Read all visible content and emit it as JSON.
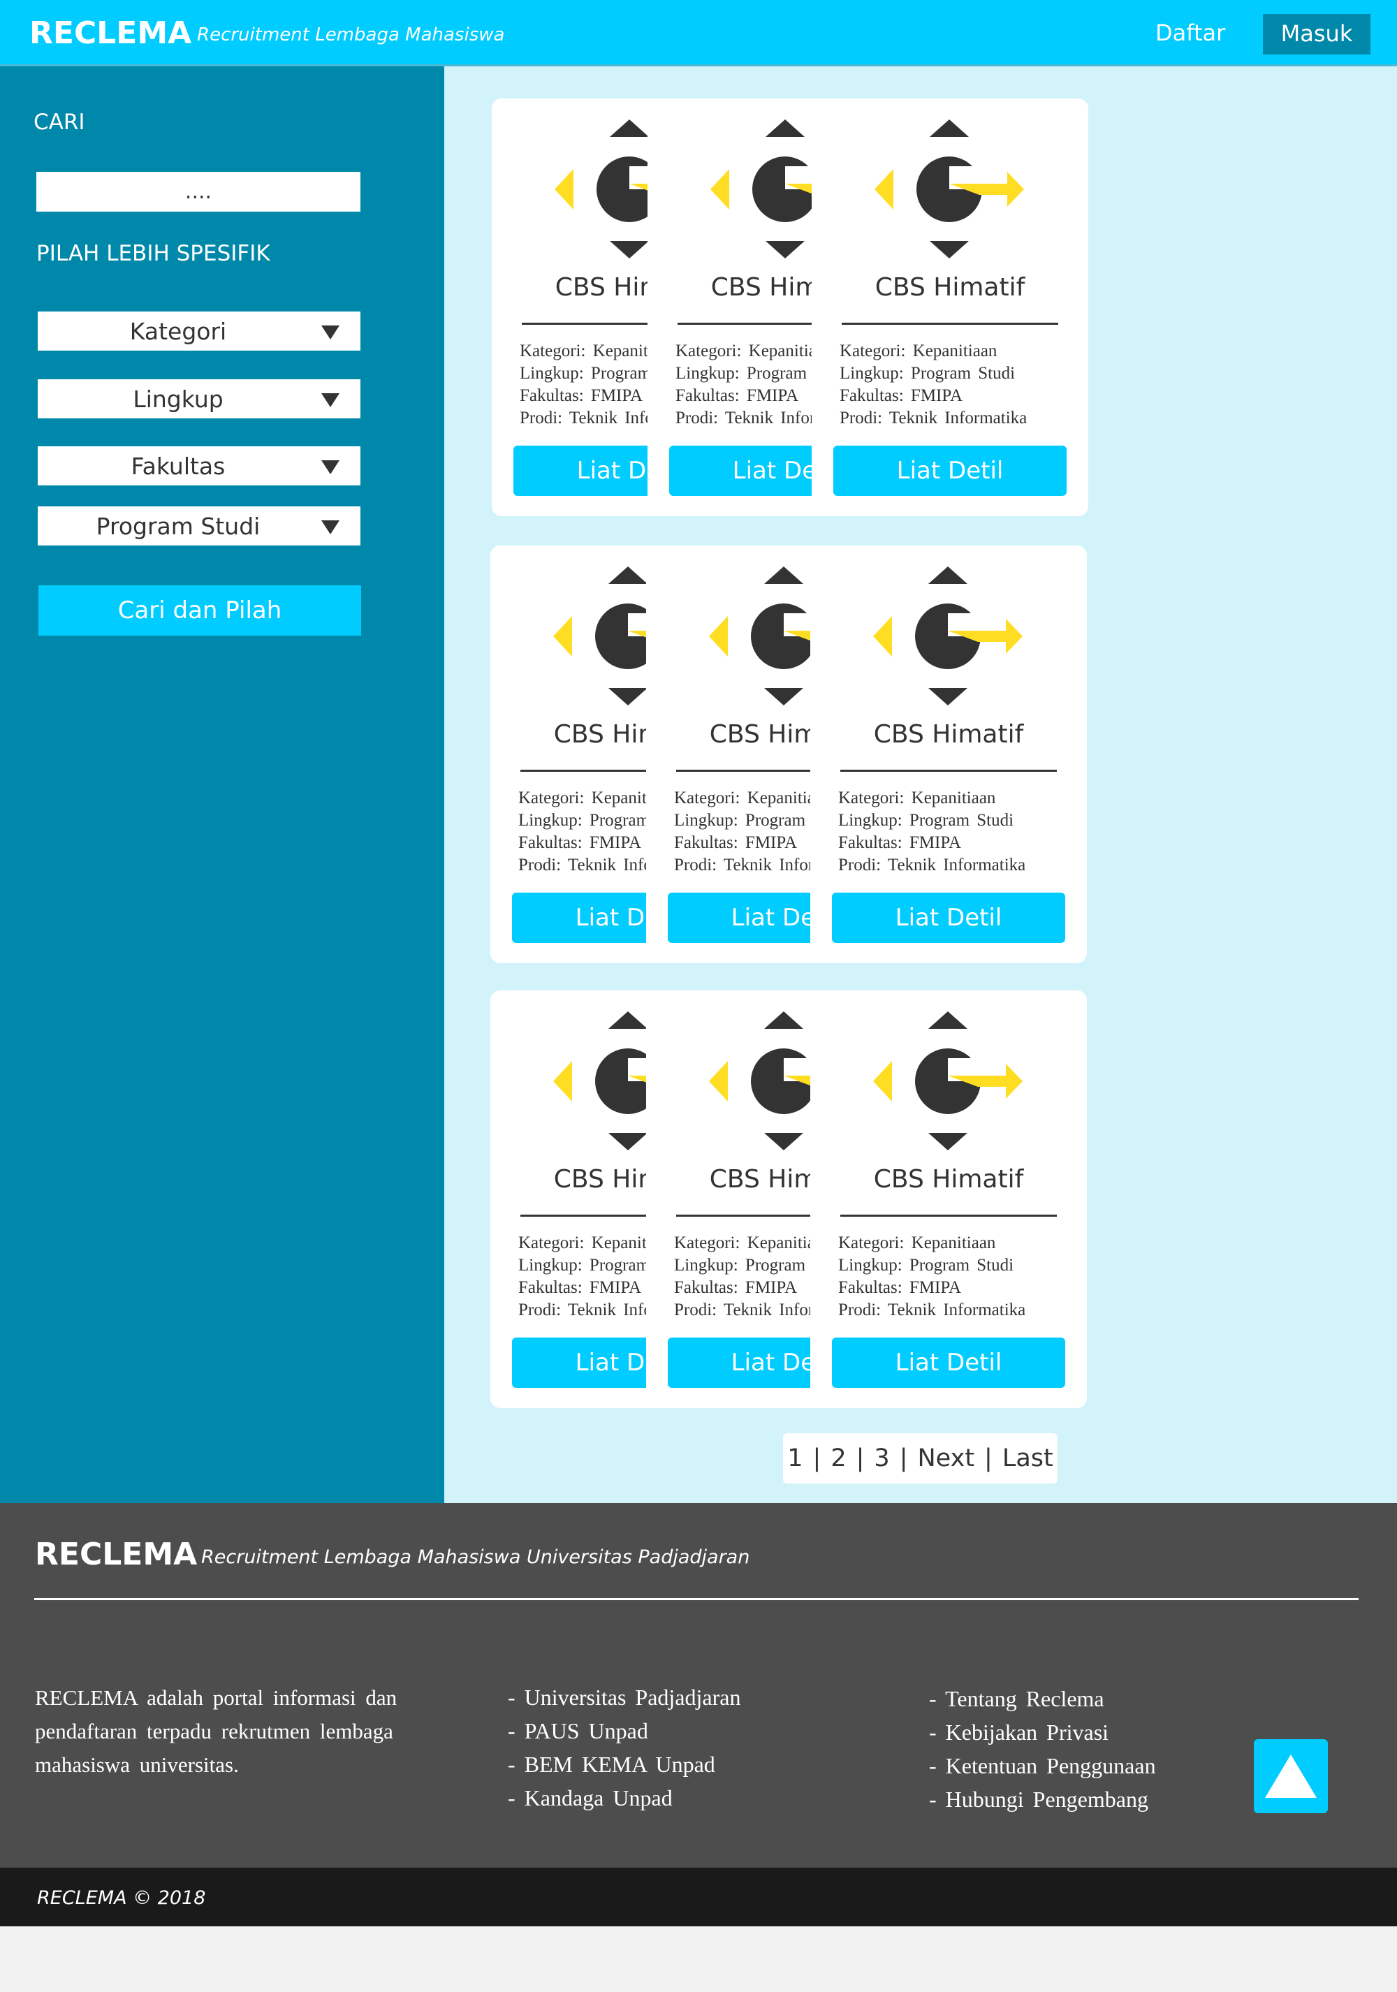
{
  "header": {
    "brand": "RECLEMA",
    "subtitle": "Recruitment Lembaga Mahasiswa",
    "nav_daftar": "Daftar",
    "nav_masuk": "Masuk"
  },
  "sidebar": {
    "search_label": "CARI",
    "search_placeholder": "....",
    "filter_label": "PILAH LEBIH SPESIFIK",
    "filters": [
      {
        "label": "Kategori"
      },
      {
        "label": "Lingkup"
      },
      {
        "label": "Fakultas"
      },
      {
        "label": "Program Studi"
      }
    ],
    "submit_label": "Cari dan Pilah"
  },
  "cards": [
    {
      "title": "CBS Himatif",
      "kategori": "Kategori:  Kepanitiaan",
      "lingkup": "Lingkup:  Program  Studi",
      "fakultas": "Fakultas:  FMIPA",
      "prodi": "Prodi:  Teknik  Informatika",
      "button": "Liat Detil"
    },
    {
      "title": "CBS Himatif",
      "kategori": "Kategori:  Kepanitiaan",
      "lingkup": "Lingkup:  Program  Studi",
      "fakultas": "Fakultas:  FMIPA",
      "prodi": "Prodi:  Teknik  Informatika",
      "button": "Liat Detil"
    },
    {
      "title": "CBS Himatif",
      "kategori": "Kategori:  Kepanitiaan",
      "lingkup": "Lingkup:  Program  Studi",
      "fakultas": "Fakultas:  FMIPA",
      "prodi": "Prodi:  Teknik  Informatika",
      "button": "Liat Detil"
    },
    {
      "title": "CBS Himatif",
      "kategori": "Kategori:  Kepanitiaan",
      "lingkup": "Lingkup:  Program  Studi",
      "fakultas": "Fakultas:  FMIPA",
      "prodi": "Prodi:  Teknik  Informatika",
      "button": "Liat Detil"
    },
    {
      "title": "CBS Himatif",
      "kategori": "Kategori:  Kepanitiaan",
      "lingkup": "Lingkup:  Program  Studi",
      "fakultas": "Fakultas:  FMIPA",
      "prodi": "Prodi:  Teknik  Informatika",
      "button": "Liat Detil"
    },
    {
      "title": "CBS Himatif",
      "kategori": "Kategori:  Kepanitiaan",
      "lingkup": "Lingkup:  Program  Studi",
      "fakultas": "Fakultas:  FMIPA",
      "prodi": "Prodi:  Teknik  Informatika",
      "button": "Liat Detil"
    },
    {
      "title": "CBS Himatif",
      "kategori": "Kategori:  Kepanitiaan",
      "lingkup": "Lingkup:  Program  Studi",
      "fakultas": "Fakultas:  FMIPA",
      "prodi": "Prodi:  Teknik  Informatika",
      "button": "Liat Detil"
    },
    {
      "title": "CBS Himatif",
      "kategori": "Kategori:  Kepanitiaan",
      "lingkup": "Lingkup:  Program  Studi",
      "fakultas": "Fakultas:  FMIPA",
      "prodi": "Prodi:  Teknik  Informatika",
      "button": "Liat Detil"
    },
    {
      "title": "CBS Himatif",
      "kategori": "Kategori:  Kepanitiaan",
      "lingkup": "Lingkup:  Program  Studi",
      "fakultas": "Fakultas:  FMIPA",
      "prodi": "Prodi:  Teknik  Informatika",
      "button": "Liat Detil"
    }
  ],
  "pagination": {
    "pages": [
      "1",
      "2",
      "3"
    ],
    "next": "Next",
    "last": "Last",
    "separator": "|"
  },
  "footer": {
    "brand": "RECLEMA",
    "subtitle": "Recruitment Lembaga Mahasiswa Universitas Padjadjaran",
    "about": "RECLEMA adalah portal informasi dan pendaftaran terpadu rekrutmen lembaga mahasiswa universitas.",
    "links_left": [
      "-  Universitas  Padjadjaran",
      "-  PAUS  Unpad",
      "-  BEM  KEMA  Unpad",
      "-  Kandaga  Unpad"
    ],
    "links_right": [
      "-  Tentang  Reclema",
      "-  Kebijakan  Privasi",
      "-  Ketentuan  Penggunaan",
      "-  Hubungi  Pengembang"
    ],
    "copyright": "RECLEMA © 2018"
  },
  "colors": {
    "header_bg": "#00ccff",
    "sidebar_bg": "#0088aa",
    "main_bg": "#d3f3fb",
    "footer_bg": "#4d4d4d",
    "accent_yellow": "#ffdd22",
    "logo_dark": "#333333"
  },
  "icons": {
    "select_caret": "caret-down-icon",
    "card_logo": "cbs-himatif-logo",
    "back_to_top": "arrow-up-icon"
  }
}
